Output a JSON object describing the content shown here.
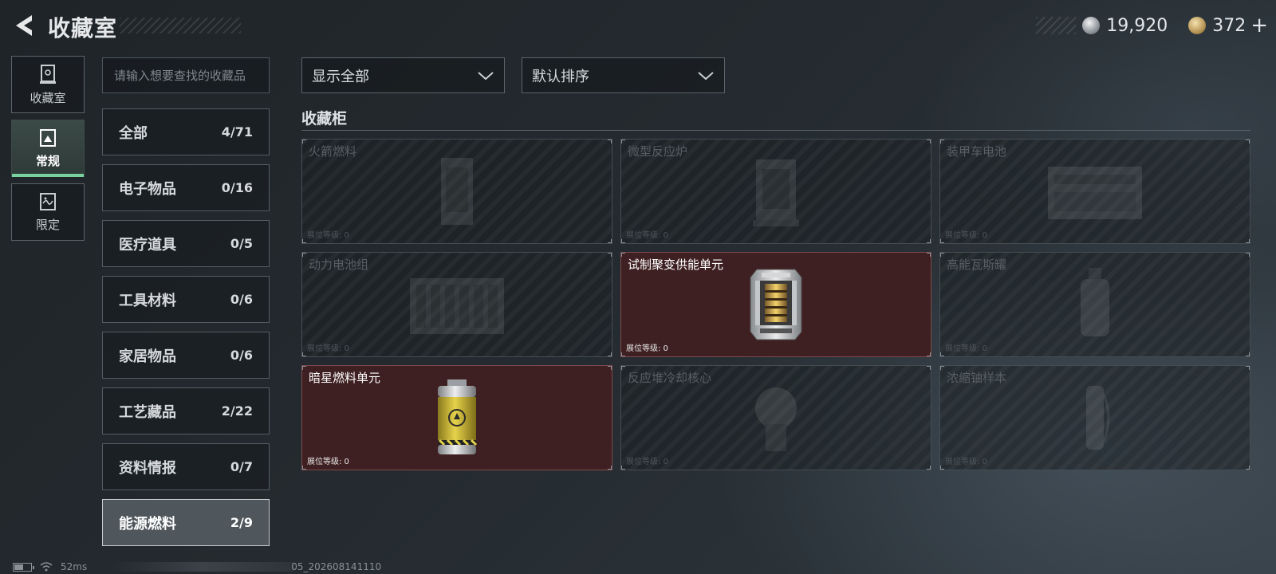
{
  "header": {
    "title": "收藏室",
    "currencies": [
      {
        "value": "19,920",
        "icon": "silver-coin-icon"
      },
      {
        "value": "372",
        "icon": "gold-coin-icon"
      }
    ],
    "plus_label": "+"
  },
  "rail": [
    {
      "label": "收藏室",
      "icon": "collection-room-icon",
      "active": false
    },
    {
      "label": "常规",
      "icon": "regular-icon",
      "active": true
    },
    {
      "label": "限定",
      "icon": "limited-icon",
      "active": false
    }
  ],
  "search": {
    "placeholder": "请输入想要查找的收藏品",
    "value": ""
  },
  "categories": [
    {
      "name": "全部",
      "count": "4/71"
    },
    {
      "name": "电子物品",
      "count": "0/16"
    },
    {
      "name": "医疗道具",
      "count": "0/5"
    },
    {
      "name": "工具材料",
      "count": "0/6"
    },
    {
      "name": "家居物品",
      "count": "0/6"
    },
    {
      "name": "工艺藏品",
      "count": "2/22"
    },
    {
      "name": "资料情报",
      "count": "0/7"
    },
    {
      "name": "能源燃料",
      "count": "2/9",
      "active": true
    }
  ],
  "filters": {
    "show": "显示全部",
    "sort": "默认排序"
  },
  "section": {
    "title": "收藏柜"
  },
  "slots": [
    {
      "name": "火箭燃料",
      "level": "展位等级: 0",
      "owned": false,
      "icon": "rocket-fuel-icon"
    },
    {
      "name": "微型反应炉",
      "level": "展位等级: 0",
      "owned": false,
      "icon": "micro-reactor-icon"
    },
    {
      "name": "装甲车电池",
      "level": "展位等级: 0",
      "owned": false,
      "icon": "armored-battery-icon"
    },
    {
      "name": "动力电池组",
      "level": "展位等级: 0",
      "owned": false,
      "icon": "power-battery-pack-icon"
    },
    {
      "name": "试制聚变供能单元",
      "level": "展位等级: 0",
      "owned": true,
      "icon": "fusion-power-unit-icon"
    },
    {
      "name": "高能瓦斯罐",
      "level": "展位等级: 0",
      "owned": false,
      "icon": "gas-canister-icon"
    },
    {
      "name": "暗星燃料单元",
      "level": "展位等级: 0",
      "owned": true,
      "icon": "darkstar-fuel-cell-icon"
    },
    {
      "name": "反应堆冷却核心",
      "level": "展位等级: 0",
      "owned": false,
      "icon": "reactor-cooling-core-icon"
    },
    {
      "name": "浓缩铀样本",
      "level": "展位等级: 0",
      "owned": false,
      "icon": "uranium-sample-icon"
    }
  ],
  "status": {
    "ping": "52ms",
    "build": "05_202608141110",
    "battery_level": 0.55
  },
  "colors": {
    "accent": "#77d2a0",
    "owned_bg": "#3f2022",
    "active_category_bg": "#4f565c"
  }
}
